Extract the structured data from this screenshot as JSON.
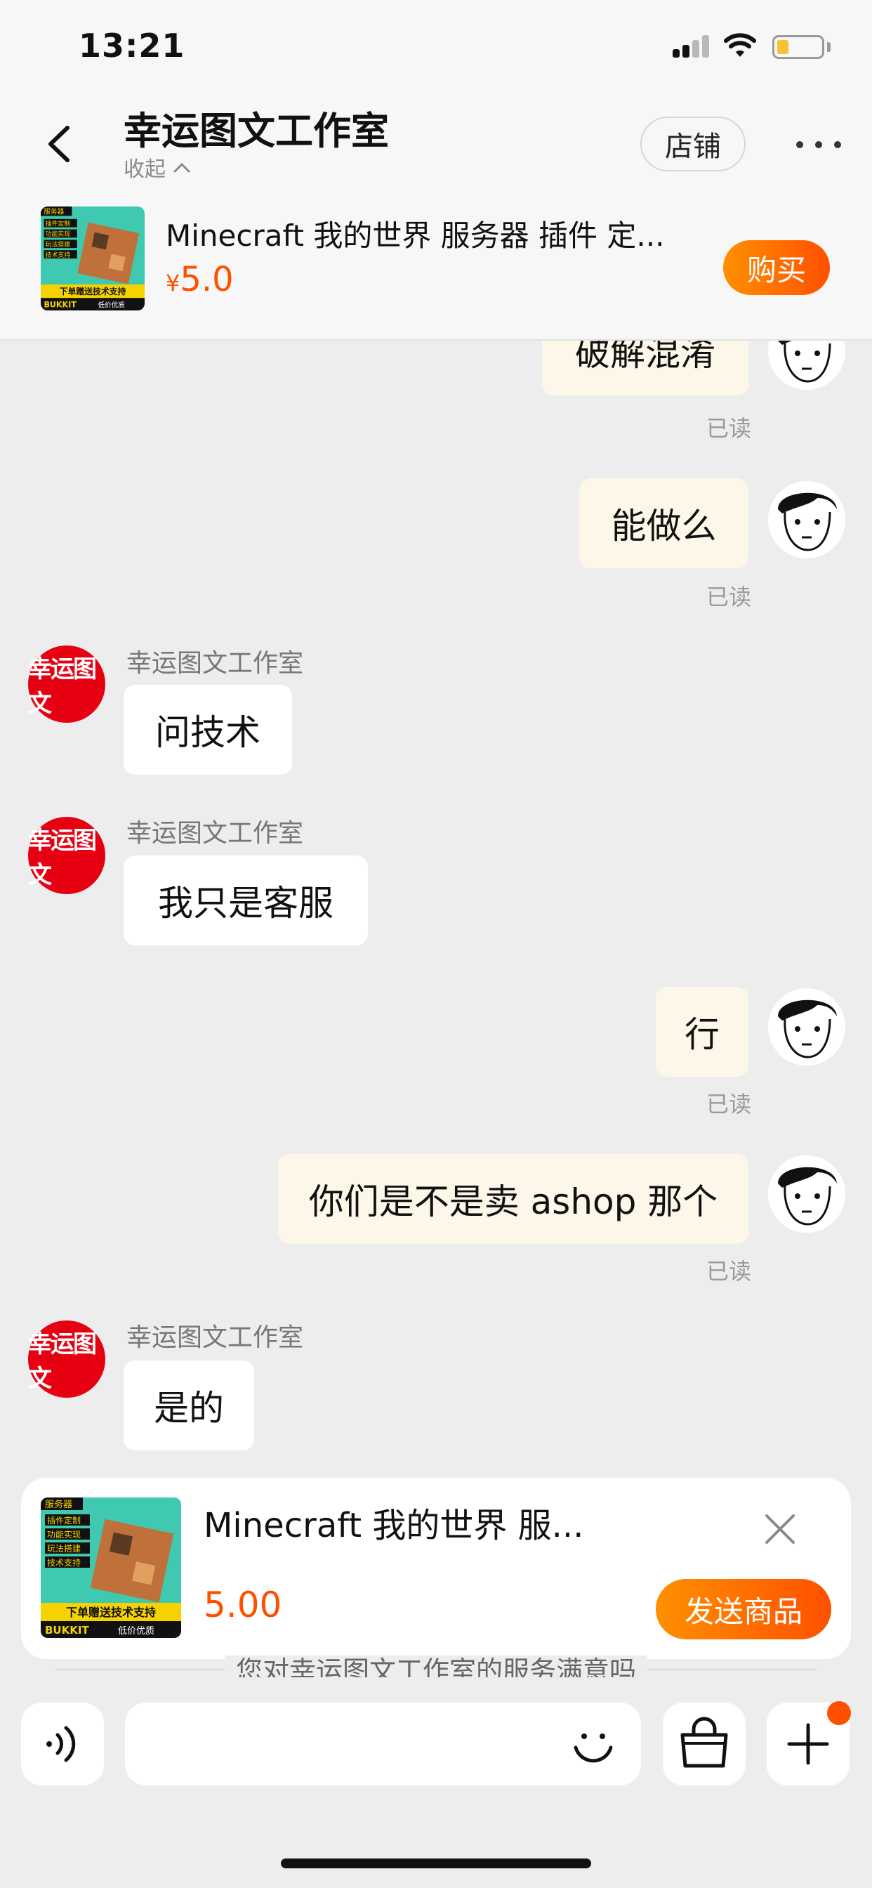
{
  "status_bar": {
    "time": "13:21"
  },
  "header": {
    "shop_name": "幸运图文工作室",
    "collapse_label": "收起",
    "store_button": "店铺"
  },
  "product": {
    "title": "Minecraft 我的世界 服务器 插件 定...",
    "currency": "¥",
    "price": "5.0",
    "buy_button": "购买",
    "thumb_texts": [
      "服务器",
      "插件定制",
      "功能实现",
      "玩法搭建",
      "技术支持",
      "下单赠送技术支持",
      "BUKKIT",
      "低价优质"
    ]
  },
  "messages": [
    {
      "from": "me",
      "text": "破解混淆",
      "status": "已读"
    },
    {
      "from": "me",
      "text": "能做么",
      "status": "已读"
    },
    {
      "from": "shop",
      "sender": "幸运图文工作室",
      "text": "问技术"
    },
    {
      "from": "shop",
      "sender": "幸运图文工作室",
      "text": "我只是客服"
    },
    {
      "from": "me",
      "text": "行",
      "status": "已读"
    },
    {
      "from": "me",
      "text": "你们是不是卖 ashop 那个",
      "status": "已读"
    },
    {
      "from": "shop",
      "sender": "幸运图文工作室",
      "text": "是的"
    }
  ],
  "shop_avatar_text": "幸运图文",
  "send_card": {
    "title": "Minecraft 我的世界 服...",
    "price": "5.00",
    "send_button": "发送商品"
  },
  "survey_text": "您对幸运图文工作室的服务满意吗",
  "input": {
    "placeholder": "",
    "value": ""
  },
  "colors": {
    "accent": "#ff5000",
    "accent_start": "#ff9000",
    "my_bubble": "#fdf7ea",
    "shop_avatar": "#e60012"
  }
}
